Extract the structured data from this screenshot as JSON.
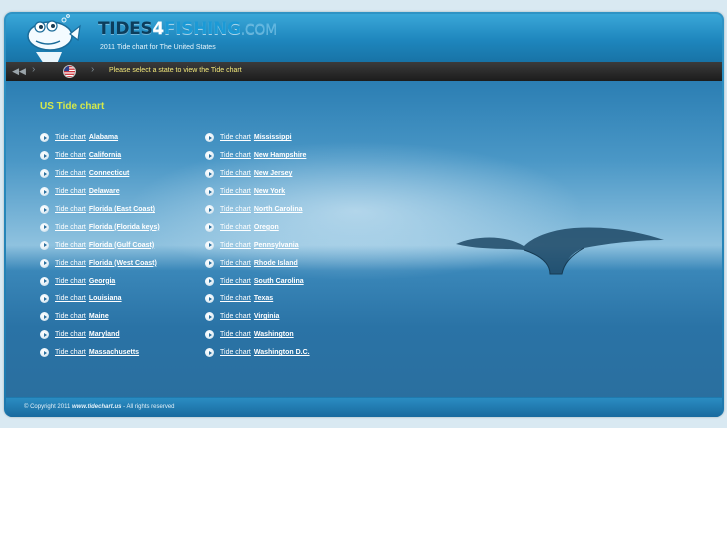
{
  "header": {
    "logo": {
      "part1": "TIDES",
      "part2": "4",
      "part3": "FISHING",
      "tld": ".COM"
    },
    "subtitle": "2011 Tide chart for The United States"
  },
  "nav": {
    "message": "Please select a state to view the Tide chart",
    "home_icon": "back-arrow-icon",
    "flag_icon": "us-flag-icon"
  },
  "main": {
    "title": "US Tide chart",
    "link_prefix": "Tide chart",
    "left_states": [
      "Alabama",
      "California",
      "Connecticut",
      "Delaware",
      "Florida (East Coast)",
      "Florida (Florida keys)",
      "Florida (Gulf Coast)",
      "Florida (West Coast)",
      "Georgia",
      "Louisiana",
      "Maine",
      "Maryland",
      "Massachusetts"
    ],
    "right_states": [
      "Mississippi",
      "New Hampshire",
      "New Jersey",
      "New York",
      "North Carolina",
      "Oregon",
      "Pennsylvania",
      "Rhode Island",
      "South Carolina",
      "Texas",
      "Virginia",
      "Washington",
      "Washington D.C."
    ]
  },
  "footer": {
    "prefix": "© Copyright 2011",
    "site": "www.tidechart.us",
    "suffix": "- All rights reserved"
  },
  "colors": {
    "title": "#d6e94a",
    "nav_text": "#f4e97a",
    "header_blue": "#1e86bd"
  }
}
